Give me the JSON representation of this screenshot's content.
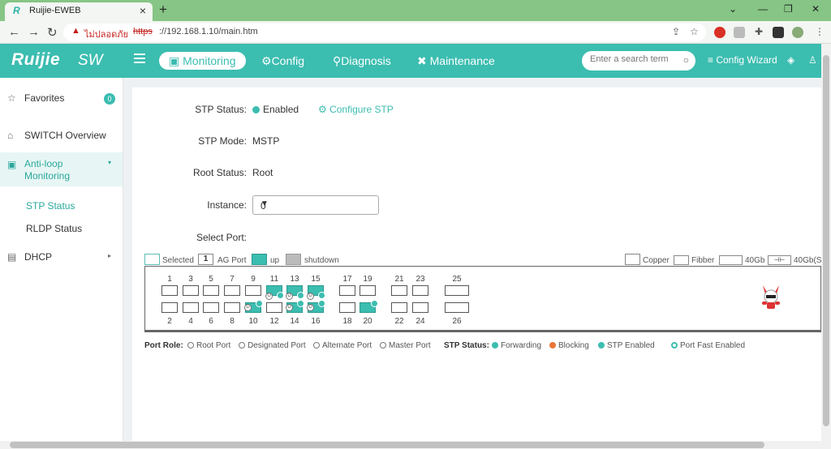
{
  "browser": {
    "tab_title": "Ruijie-EWEB",
    "tab_logo": "R",
    "security_warning": "ไม่ปลอดภัย",
    "url_scheme": "https",
    "url_rest": "://192.168.1.10/main.htm"
  },
  "header": {
    "brand": "Ruijie",
    "brand_suffix": "SW",
    "nav": [
      {
        "label": "Monitoring",
        "icon": "monitor-icon"
      },
      {
        "label": "Config",
        "icon": "gear-icon"
      },
      {
        "label": "Diagnosis",
        "icon": "diagnosis-icon"
      },
      {
        "label": "Maintenance",
        "icon": "tools-icon"
      }
    ],
    "search_placeholder": "Enter a search term",
    "config_wizard": "Config Wizard"
  },
  "sidebar": {
    "favorites": "Favorites",
    "favorites_count": "0",
    "items": [
      {
        "label": "SWITCH Overview"
      },
      {
        "label": "Anti-loop Monitoring"
      },
      {
        "label": "STP Status"
      },
      {
        "label": "RLDP Status"
      },
      {
        "label": "DHCP"
      }
    ]
  },
  "main": {
    "stp_status_label": "STP Status:",
    "stp_status_value": "Enabled",
    "configure_stp": "Configure STP",
    "stp_mode_label": "STP Mode:",
    "stp_mode_value": "MSTP",
    "root_status_label": "Root Status:",
    "root_status_value": "Root",
    "instance_label": "Instance:",
    "instance_value": "0",
    "select_port_label": "Select Port:"
  },
  "legend": {
    "selected": "Selected",
    "ag_badge": "1",
    "ag_port": "AG Port",
    "up": "up",
    "shutdown": "shutdown",
    "copper": "Copper",
    "fibber": "Fibber",
    "g40": "40Gb",
    "g40s": "40Gb(S"
  },
  "ports": {
    "top": [
      "1",
      "3",
      "5",
      "7",
      "9",
      "11",
      "13",
      "15",
      "17",
      "19",
      "21",
      "23",
      "25"
    ],
    "bottom": [
      "2",
      "4",
      "6",
      "8",
      "10",
      "12",
      "14",
      "16",
      "18",
      "20",
      "22",
      "24",
      "26"
    ]
  },
  "role_legend": {
    "port_role": "Port Role:",
    "root_port": "Root Port",
    "designated_port": "Designated Port",
    "alternate_port": "Alternate Port",
    "master_port": "Master Port",
    "stp_status": "STP Status:",
    "forwarding": "Forwarding",
    "blocking": "Blocking",
    "stp_enabled": "STP Enabled",
    "port_fast": "Port Fast Enabled"
  },
  "colors": {
    "accent": "#3bbdb0",
    "blocking": "#e8773a",
    "chrome": "#86c585"
  }
}
